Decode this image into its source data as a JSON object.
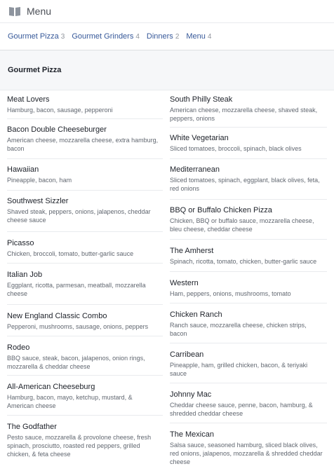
{
  "header": {
    "title": "Menu",
    "icon": "book-icon"
  },
  "tabs": [
    {
      "label": "Gourmet Pizza",
      "count": "3"
    },
    {
      "label": "Gourmet Grinders",
      "count": "4"
    },
    {
      "label": "Dinners",
      "count": "2"
    },
    {
      "label": "Menu",
      "count": "4"
    }
  ],
  "section": {
    "title": "Gourmet Pizza"
  },
  "left_items": [
    {
      "name": "Meat Lovers",
      "desc": "Hamburg, bacon, sausage, pepperoni"
    },
    {
      "name": "Bacon Double Cheeseburger",
      "desc": "American cheese, mozzarella cheese, extra hamburg, bacon"
    },
    {
      "name": "Hawaiian",
      "desc": "Pineapple, bacon, ham"
    },
    {
      "name": "Southwest Sizzler",
      "desc": "Shaved steak, peppers, onions, jalapenos, cheddar cheese sauce"
    },
    {
      "name": "Picasso",
      "desc": "Chicken, broccoli, tomato, butter-garlic sauce"
    },
    {
      "name": "Italian Job",
      "desc": "Eggplant, ricotta, parmesan, meatball, mozzarella cheese"
    },
    {
      "name": "New England Classic Combo",
      "desc": "Pepperoni, mushrooms, sausage, onions, peppers"
    },
    {
      "name": "Rodeo",
      "desc": "BBQ sauce, steak, bacon, jalapenos, onion rings, mozzarella & cheddar cheese"
    },
    {
      "name": "All-American Cheeseburg",
      "desc": "Hamburg, bacon, mayo, ketchup, mustard, & American cheese"
    },
    {
      "name": "The Godfather",
      "desc": "Pesto sauce, mozzarella & provolone cheese, fresh spinach, prosciutto, roasted red peppers, grilled chicken, & feta cheese"
    }
  ],
  "right_items": [
    {
      "name": "South Philly Steak",
      "desc": "American cheese, mozzarella cheese, shaved steak, peppers, onions"
    },
    {
      "name": "White Vegetarian",
      "desc": "Sliced tomatoes, broccoli, spinach, black olives"
    },
    {
      "name": "Mediterranean",
      "desc": "Sliced tomatoes, spinach, eggplant, black olives, feta, red onions"
    },
    {
      "name": "BBQ or Buffalo Chicken Pizza",
      "desc": "Chicken, BBQ or buffalo sauce, mozzarella cheese, bleu cheese, cheddar cheese"
    },
    {
      "name": "The Amherst",
      "desc": "Spinach, ricotta, tomato, chicken, butter-garlic sauce"
    },
    {
      "name": "Western",
      "desc": "Ham, peppers, onions, mushrooms, tomato"
    },
    {
      "name": "Chicken Ranch",
      "desc": "Ranch sauce, mozzarella cheese, chicken strips, bacon"
    },
    {
      "name": "Carribean",
      "desc": "Pineapple, ham, grilled chicken, bacon, & teriyaki sauce"
    },
    {
      "name": "Johnny Mac",
      "desc": "Cheddar cheese sauce, penne, bacon, hamburg, & shredded cheddar cheese"
    },
    {
      "name": "The Mexican",
      "desc": "Salsa sauce, seasoned hamburg, sliced black olives, red onions, jalapenos, mozzarella & shredded cheddar cheese"
    }
  ]
}
